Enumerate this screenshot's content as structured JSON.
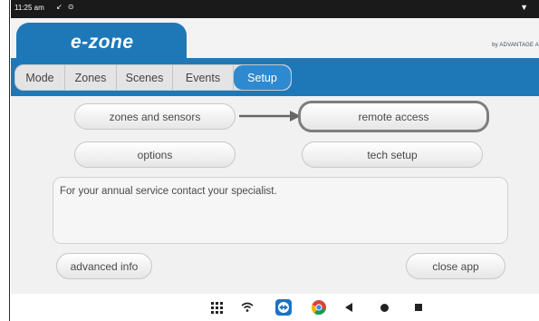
{
  "status_bar": {
    "time": "11:25 am",
    "icons": "↙ ⊙",
    "signal": "▼"
  },
  "header": {
    "logo": "e-zone",
    "brand": "by ADVANTAGE A"
  },
  "tabs": [
    {
      "label": "Mode",
      "active": false
    },
    {
      "label": "Zones",
      "active": false
    },
    {
      "label": "Scenes",
      "active": false
    },
    {
      "label": "Events",
      "active": false
    },
    {
      "label": "Setup",
      "active": true
    }
  ],
  "buttons": {
    "zones_sensors": "zones and sensors",
    "remote_access": "remote access",
    "options": "options",
    "tech_setup": "tech setup",
    "advanced_info": "advanced info",
    "close_app": "close app"
  },
  "message": "For your annual service contact your specialist.",
  "nav": {
    "icons": [
      "apps-grid-icon",
      "wifi-icon",
      "teamviewer-icon",
      "chrome-icon",
      "back-icon",
      "home-icon",
      "recents-icon"
    ]
  },
  "colors": {
    "accent_blue": "#1e78b8",
    "active_tab": "#2e8ad0",
    "selected_border": "#7e7e7e"
  }
}
